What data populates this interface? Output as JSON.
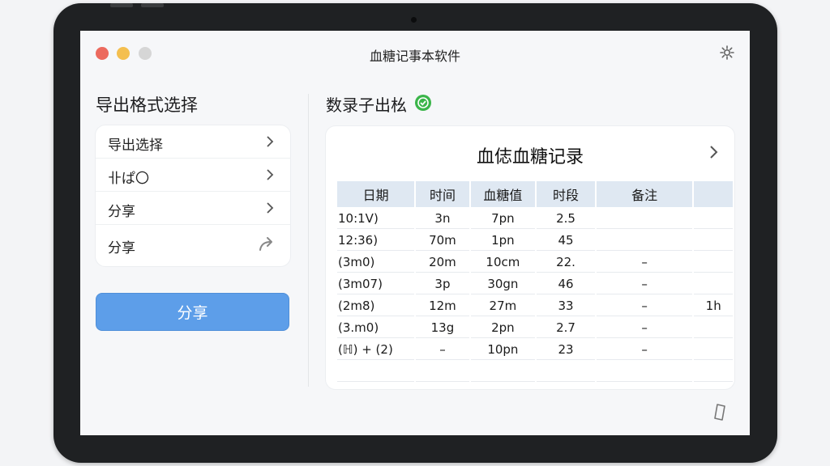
{
  "window": {
    "title": "血糖记事本软件",
    "traffic_lights": [
      "#ec6a5e",
      "#f4bf4f",
      "#d6d6d6"
    ]
  },
  "left_panel": {
    "title": "导出格式选择",
    "items": [
      {
        "label": "导出选择",
        "icon": "chevron-right-icon"
      },
      {
        "label": "卝ぱ〇",
        "icon": "chevron-right-icon"
      },
      {
        "label": "分享",
        "icon": "chevron-right-icon"
      },
      {
        "label": "分享",
        "icon": "share-arrow-icon"
      }
    ],
    "share_button": "分享"
  },
  "right_panel": {
    "title": "数录子出㭃",
    "card_title": "血俧血糖记录",
    "columns": [
      "日期",
      "时间",
      "血糖值",
      "时段",
      "备注",
      ""
    ],
    "rows": [
      [
        "10:1V)",
        "3n",
        "7pn",
        "2.5",
        "",
        ""
      ],
      [
        "12:36)",
        "70m",
        "1pn",
        "45",
        "",
        ""
      ],
      [
        "(3m0)",
        "20m",
        "10cm",
        "22.",
        "–",
        ""
      ],
      [
        "(3m07)",
        "3p",
        "30gn",
        "46",
        "–",
        ""
      ],
      [
        "(2m8)",
        "12m",
        "27m",
        "33",
        "–",
        "1h"
      ],
      [
        "(3.m0)",
        "13g",
        "2pn",
        "2.7",
        "–",
        ""
      ],
      [
        "(ℍ) + (2)",
        "–",
        "10pn",
        "23",
        "–",
        ""
      ],
      [
        "",
        "",
        "",
        "",
        "",
        ""
      ],
      [
        "",
        "",
        "",
        "",
        "",
        ""
      ]
    ]
  },
  "colors": {
    "accent": "#5d9ee9",
    "check": "#3bb54a",
    "table_header": "#dfe8f2"
  }
}
